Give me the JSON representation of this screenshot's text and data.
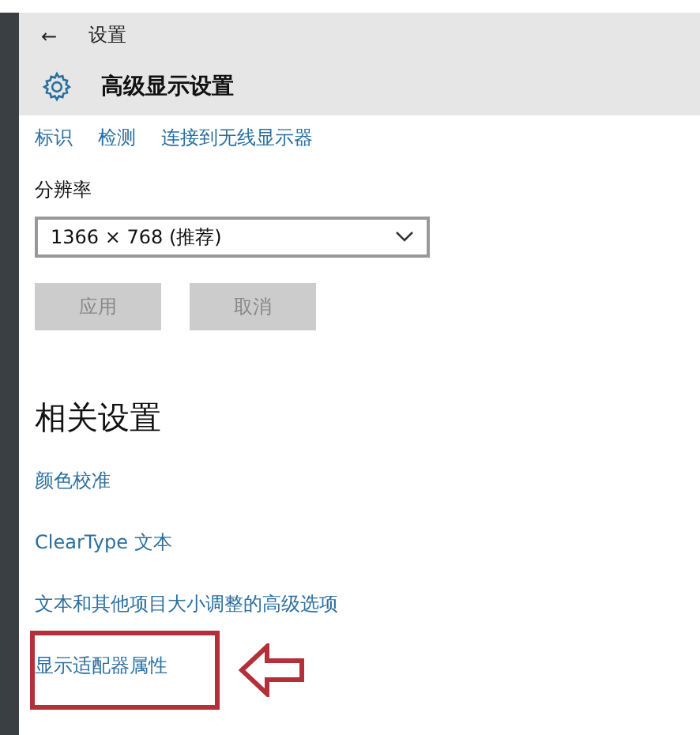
{
  "window": {
    "back": "←",
    "title": "设置"
  },
  "header": {
    "title": "高级显示设置"
  },
  "top_links": [
    "标识",
    "检测",
    "连接到无线显示器"
  ],
  "resolution": {
    "label": "分辨率",
    "value": "1366 × 768 (推荐)"
  },
  "buttons": [
    {
      "label": "应用",
      "disabled": true
    },
    {
      "label": "取消",
      "disabled": true
    }
  ],
  "related": {
    "heading": "相关设置",
    "links": [
      {
        "label": "颜色校准",
        "highlighted": false
      },
      {
        "label": "ClearType 文本",
        "highlighted": false
      },
      {
        "label": "文本和其他项目大小调整的高级选项",
        "highlighted": false
      },
      {
        "label": "显示适配器属性",
        "highlighted": true
      }
    ]
  }
}
